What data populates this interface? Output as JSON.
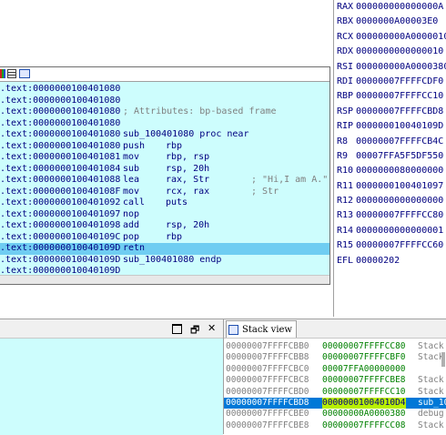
{
  "registers": [
    {
      "name": "RAX",
      "value": "000000000000000A"
    },
    {
      "name": "RBX",
      "value": "0000000A00003E0"
    },
    {
      "name": "RCX",
      "value": "000000000A0000010"
    },
    {
      "name": "RDX",
      "value": "0000000000000010"
    },
    {
      "name": "RSI",
      "value": "000000000A0000380"
    },
    {
      "name": "RDI",
      "value": "00000007FFFFCDF0"
    },
    {
      "name": "RBP",
      "value": "00000007FFFFCC10"
    },
    {
      "name": "RSP",
      "value": "00000007FFFFCBD8"
    },
    {
      "name": "RIP",
      "value": "000000010040109D"
    },
    {
      "name": "R8",
      "value": "00000007FFFFCB4C"
    },
    {
      "name": "R9",
      "value": "00007FFA5F5DF550"
    },
    {
      "name": "R10",
      "value": "0000000080000000"
    },
    {
      "name": "R11",
      "value": "0000000100401097"
    },
    {
      "name": "R12",
      "value": "0000000000000000"
    },
    {
      "name": "R13",
      "value": "00000007FFFFCC80"
    },
    {
      "name": "R14",
      "value": "0000000000000001"
    },
    {
      "name": "R15",
      "value": "00000007FFFFCC60"
    },
    {
      "name": "EFL",
      "value": "00000202"
    }
  ],
  "disasm": {
    "lines": [
      {
        "addr": ".text:0000000100401080",
        "kind": "plain"
      },
      {
        "addr": ".text:0000000100401080",
        "kind": "plain"
      },
      {
        "addr": ".text:0000000100401080",
        "kind": "full",
        "text": "; Attributes: bp-based frame"
      },
      {
        "addr": ".text:0000000100401080",
        "kind": "plain"
      },
      {
        "addr": ".text:0000000100401080",
        "kind": "label",
        "text": "sub_100401080 proc near"
      },
      {
        "addr": ".text:0000000100401080",
        "kind": "ins",
        "mn": "push",
        "op": "rbp"
      },
      {
        "addr": ".text:0000000100401081",
        "kind": "ins",
        "mn": "mov",
        "op": "rbp, rsp"
      },
      {
        "addr": ".text:0000000100401084",
        "kind": "ins",
        "mn": "sub",
        "op": "rsp, 20h"
      },
      {
        "addr": ".text:0000000100401088",
        "kind": "ins",
        "mn": "lea",
        "op": "rax, Str",
        "cm": "; \"Hi,I am A.\""
      },
      {
        "addr": ".text:000000010040108F",
        "kind": "ins",
        "mn": "mov",
        "op": "rcx, rax",
        "cm": "; Str"
      },
      {
        "addr": ".text:0000000100401092",
        "kind": "ins",
        "mn": "call",
        "op": "puts"
      },
      {
        "addr": ".text:0000000100401097",
        "kind": "ins",
        "mn": "nop",
        "op": ""
      },
      {
        "addr": ".text:0000000100401098",
        "kind": "ins",
        "mn": "add",
        "op": "rsp, 20h"
      },
      {
        "addr": ".text:000000010040109C",
        "kind": "ins",
        "mn": "pop",
        "op": "rbp"
      },
      {
        "addr": ".text:000000010040109D",
        "kind": "ins",
        "mn": "retn",
        "op": "",
        "selected": true
      },
      {
        "addr": ".text:000000010040109D",
        "kind": "label",
        "text": "sub_100401080 endp"
      },
      {
        "addr": ".text:000000010040109D",
        "kind": "plain"
      }
    ]
  },
  "stack": {
    "title": "Stack view",
    "rows": [
      {
        "addr": "00000007FFFFCBB0",
        "val": "00000007FFFFCC80",
        "cm": "Stack"
      },
      {
        "addr": "00000007FFFFCBB8",
        "val": "00000007FFFFCBF0",
        "cm": "Stack"
      },
      {
        "addr": "00000007FFFFCBC0",
        "val": "00007FFA00000000",
        "cm": ""
      },
      {
        "addr": "00000007FFFFCBC8",
        "val": "00000007FFFFCBE8",
        "cm": "Stack"
      },
      {
        "addr": "00000007FFFFCBD0",
        "val": "00000007FFFFCC10",
        "cm": "Stack"
      },
      {
        "addr": "00000007FFFFCBD8",
        "val": "00000001004010D4",
        "cm": "sub_10",
        "selected": true
      },
      {
        "addr": "00000007FFFFCBE0",
        "val": "00000000A0000380",
        "cm": "debug"
      },
      {
        "addr": "00000007FFFFCBE8",
        "val": "00000007FFFFCC08",
        "cm": "Stack"
      }
    ]
  },
  "bottom_left": {
    "buttons": {
      "float": "🗗",
      "close": "✕"
    }
  }
}
